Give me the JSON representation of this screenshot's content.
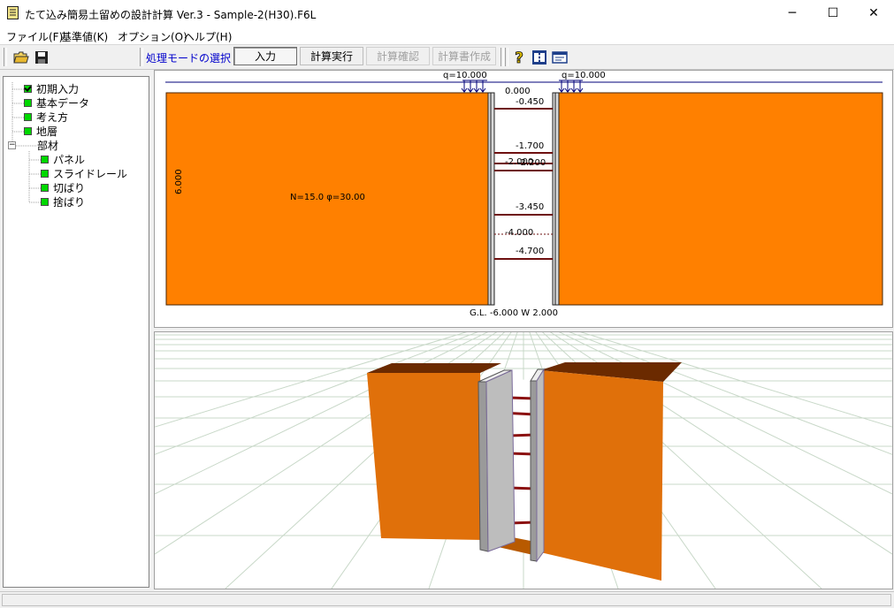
{
  "window": {
    "title": "たて込み簡易土留めの設計計算 Ver.3 - Sample-2(H30).F6L",
    "minimize_glyph": "─",
    "maximize_glyph": "☐",
    "close_glyph": "✕"
  },
  "menu": {
    "items": [
      "ファイル(F)",
      "基準値(K)",
      "オプション(O)",
      "ヘルプ(H)"
    ]
  },
  "toolbar": {
    "icons": [
      "open-folder-icon",
      "save-disk-icon",
      "help-icon",
      "model-icon",
      "screen-icon"
    ],
    "mode_label": "処理モードの選択",
    "modes": [
      {
        "label": "入力",
        "state": "active"
      },
      {
        "label": "計算実行",
        "state": "normal"
      },
      {
        "label": "計算確認",
        "state": "disabled"
      },
      {
        "label": "計算書作成",
        "state": "disabled"
      }
    ]
  },
  "tree": {
    "items": [
      {
        "label": "初期入力",
        "checked": true
      },
      {
        "label": "基本データ"
      },
      {
        "label": "考え方"
      },
      {
        "label": "地層"
      },
      {
        "label": "部材",
        "expander": "−"
      },
      {
        "label": "パネル"
      },
      {
        "label": "スライドレール"
      },
      {
        "label": "切ばり"
      },
      {
        "label": "捨ばり"
      }
    ]
  },
  "drawing2d": {
    "load_left": "q=10.000",
    "load_right": "q=10.000",
    "depth_left": "6.000",
    "soil": "N=15.0  φ=30.00",
    "levels": [
      "0.000",
      "-0.450",
      "-1.700",
      "-2.000",
      "-2.200",
      "-3.450",
      "-4.000",
      "-4.700"
    ],
    "bottom": "G.L. -6.000 W 2.000"
  },
  "colors": {
    "soil": "#ff8000",
    "soil_3d_front": "#e66e00",
    "soil_3d_top": "#7a2d00",
    "strut": "#8b1010",
    "accent_blue": "#0000cc"
  }
}
